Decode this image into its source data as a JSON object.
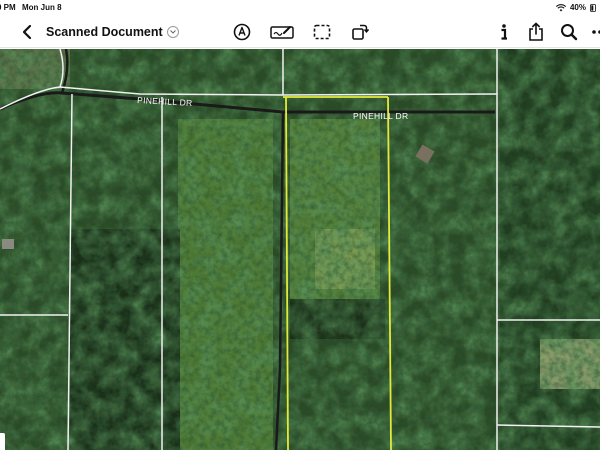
{
  "status_bar": {
    "time": "0 PM",
    "date": "Mon Jun 8",
    "battery": "40%",
    "icons": [
      "wifi-icon",
      "battery-icon"
    ]
  },
  "toolbar": {
    "document_title": "Scanned Document",
    "icons": [
      "back-chevron-icon",
      "chevron-down-icon",
      "markup-pen-icon",
      "signature-icon",
      "selection-icon",
      "rotate-icon",
      "info-icon",
      "share-icon",
      "search-icon",
      "more-icon"
    ]
  },
  "map": {
    "road_labels": [
      "PINEHILL DR",
      "PINEHILL DR"
    ],
    "colors": {
      "parcel_line": "#f2f2f2",
      "highlight_line": "#e4ea3a",
      "road_line": "#1a1a1a",
      "forest": "#1f3a1d"
    }
  }
}
